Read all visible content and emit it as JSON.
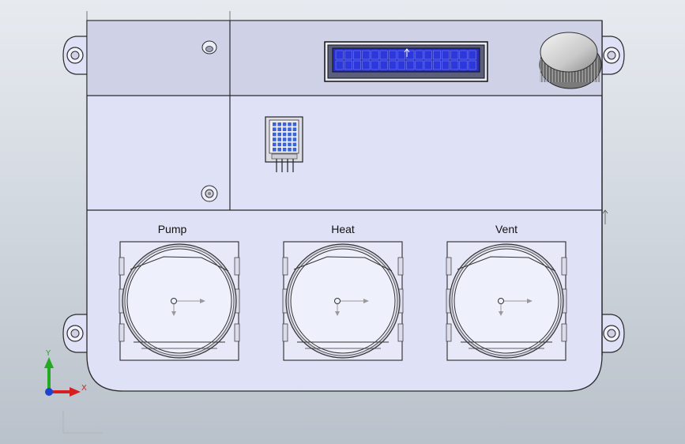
{
  "viewport": {
    "background_top": "#e7ebf0",
    "background_bottom": "#b9c1ca",
    "panel_color": "#dfe1f7",
    "panel_top_color": "#cfd2e7",
    "edge_color": "#2a2a2a",
    "lcd_color": "#2630c8"
  },
  "gauges": [
    {
      "label": "Pump"
    },
    {
      "label": "Heat"
    },
    {
      "label": "Vent"
    }
  ],
  "triad": {
    "y_label": "Y",
    "x_label": "X",
    "y_color": "#22aa22",
    "x_color": "#d42020",
    "z_color": "#2040d0"
  }
}
